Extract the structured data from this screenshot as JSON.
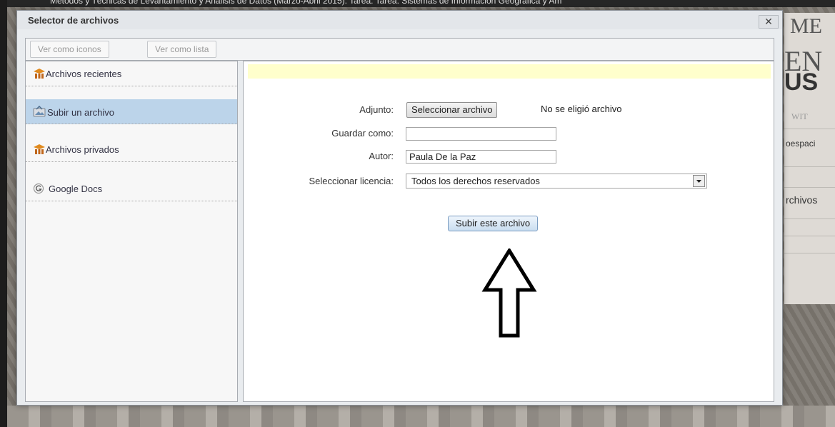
{
  "background": {
    "top_text": "Métodos y Técnicas de Levantamiento y Análisis de Datos (Marzo-Abril 2015): Tarea: Tarea: Sistemas de Información Geográfica y Am",
    "right_panel": {
      "big1": "ME",
      "big2": "EN",
      "big3": "US",
      "small1": "WIT",
      "small2": "oespaci",
      "small3": "rchivos"
    }
  },
  "dialog": {
    "title": "Selector de archivos",
    "close_symbol": "✕"
  },
  "toolbar": {
    "icons_view_label": "Ver como iconos",
    "list_view_label": "Ver como lista"
  },
  "sidebar": {
    "items": [
      {
        "label": "Archivos recientes",
        "icon": "moodle-icon"
      },
      {
        "label": "Subir un archivo",
        "icon": "upload-icon",
        "active": true
      },
      {
        "label": "Archivos privados",
        "icon": "moodle-icon"
      },
      {
        "label": "Google Docs",
        "icon": "google-icon"
      }
    ]
  },
  "form": {
    "attachment_label": "Adjunto:",
    "choose_file_label": "Seleccionar archivo",
    "no_file_text": "No se eligió archivo",
    "save_as_label": "Guardar como:",
    "save_as_value": "",
    "author_label": "Autor:",
    "author_value": "Paula De la Paz",
    "license_label": "Seleccionar licencia:",
    "license_value": "Todos los derechos reservados",
    "upload_label": "Subir este archivo"
  },
  "colors": {
    "active_item": "#bcd4ea",
    "notice_bg": "#ffffcc",
    "upload_button": "#c9ddf0"
  }
}
